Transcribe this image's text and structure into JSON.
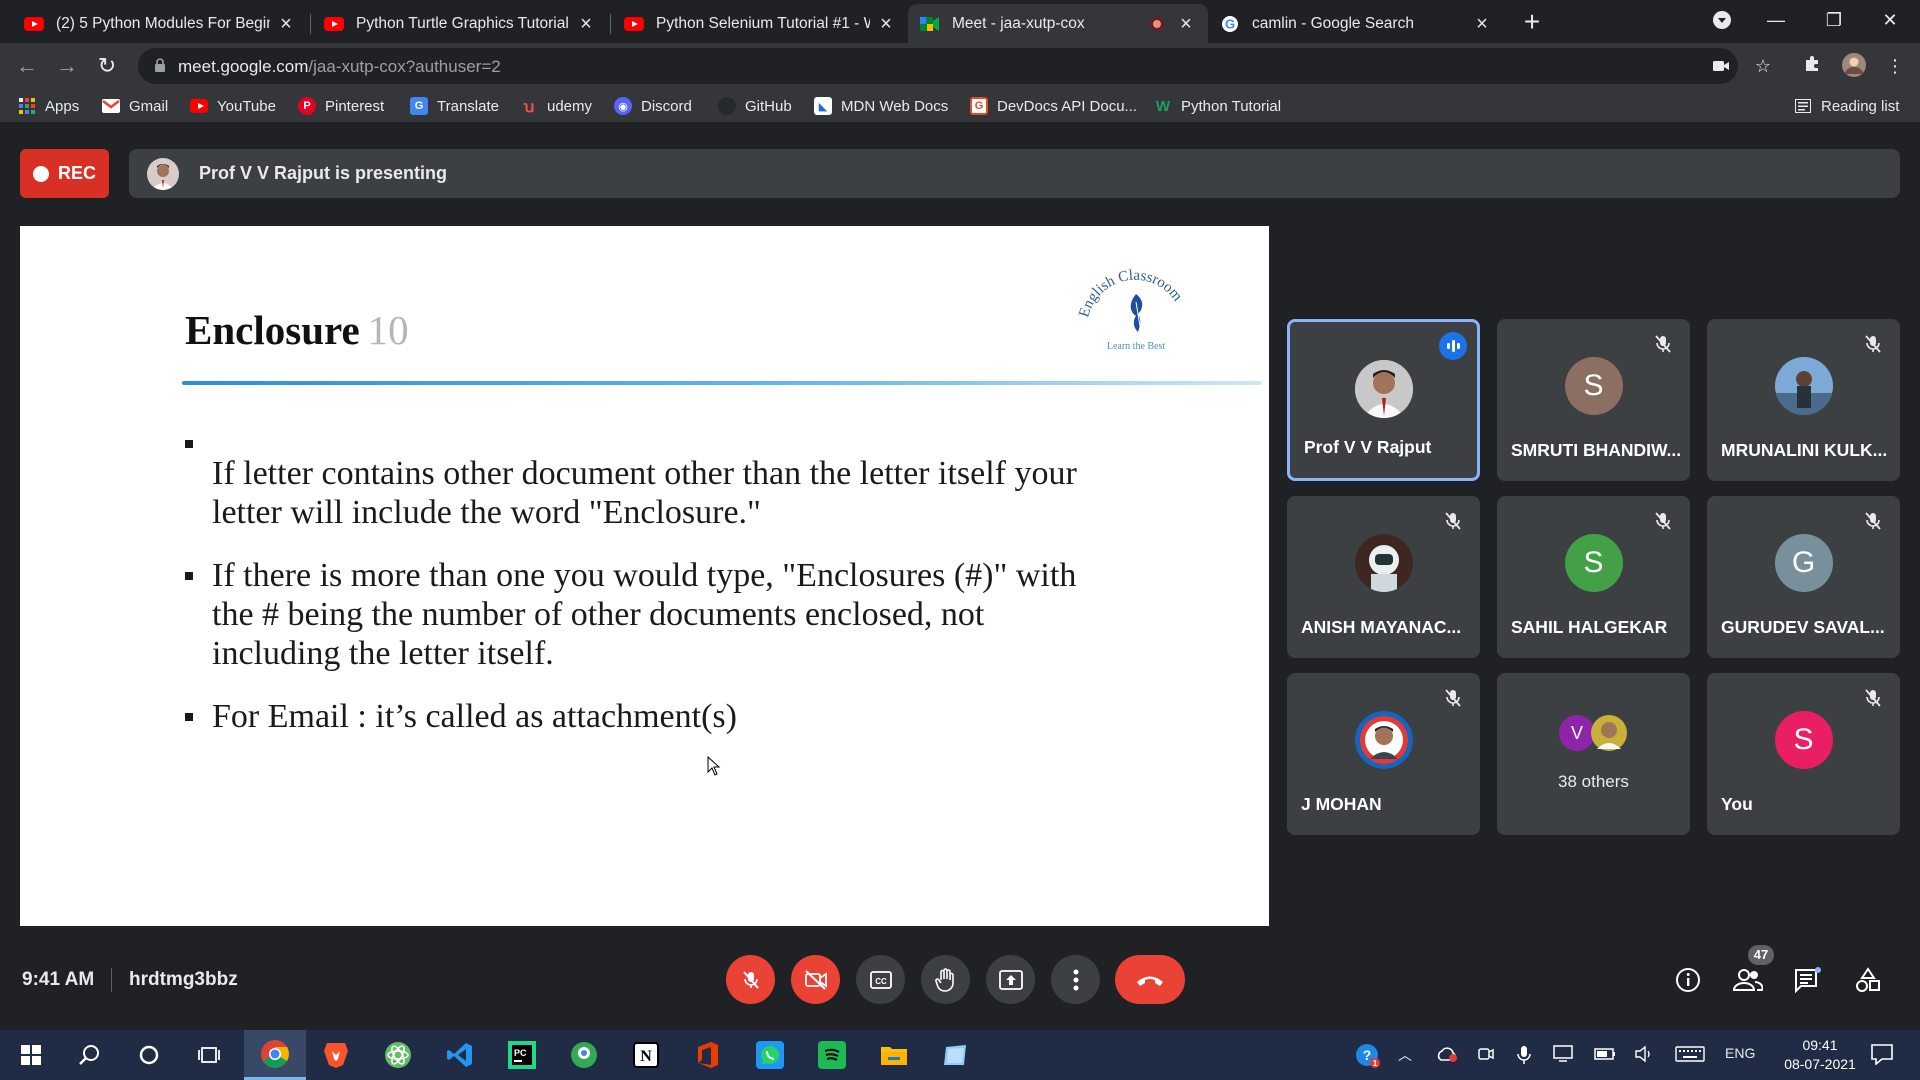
{
  "browser": {
    "tabs": [
      {
        "title": "(2) 5 Python Modules For Beginn",
        "icon": "youtube-icon"
      },
      {
        "title": "Python Turtle Graphics Tutorial #",
        "icon": "youtube-icon"
      },
      {
        "title": "Python Selenium Tutorial #1 - W",
        "icon": "youtube-icon"
      },
      {
        "title": "Meet - jaa-xutp-cox",
        "icon": "google-meet-icon",
        "active": true,
        "recording": true
      },
      {
        "title": "camlin - Google Search",
        "icon": "google-icon"
      }
    ],
    "address": {
      "host": "meet.google.com",
      "path": "/jaa-xutp-cox?authuser=2"
    },
    "bookmarks": [
      {
        "label": "Apps",
        "icon": "apps-grid-icon",
        "color": "#4285f4"
      },
      {
        "label": "Gmail",
        "icon": "gmail-icon",
        "color": "#ea4335"
      },
      {
        "label": "YouTube",
        "icon": "youtube-icon",
        "color": "#ff0000"
      },
      {
        "label": "Pinterest",
        "icon": "pinterest-icon",
        "color": "#e60023"
      },
      {
        "label": "Translate",
        "icon": "translate-icon",
        "color": "#4285f4"
      },
      {
        "label": "udemy",
        "icon": "udemy-icon",
        "color": "#ec5252"
      },
      {
        "label": "Discord",
        "icon": "discord-icon",
        "color": "#5865f2"
      },
      {
        "label": "GitHub",
        "icon": "github-icon",
        "color": "#24292e"
      },
      {
        "label": "MDN Web Docs",
        "icon": "mdn-icon",
        "color": "#1b6fc8"
      },
      {
        "label": "DevDocs API Docu...",
        "icon": "devdocs-icon",
        "color": "#e34c26"
      },
      {
        "label": "Python Tutorial",
        "icon": "python-tutorial-icon",
        "color": "#1aa260"
      }
    ],
    "reading_list": "Reading list"
  },
  "meet": {
    "rec_label": "REC",
    "presenting_text": "Prof V V Rajput is presenting",
    "slide": {
      "title": "Enclosure",
      "number": "10",
      "logo_text": "English Classroom",
      "logo_tagline": "Learn the Best",
      "bullets": [
        "If letter contains other document other than the letter itself your letter will include the word \"Enclosure.\"",
        "If there is more than one you would type, \"Enclosures (#)\" with the # being the number of other documents enclosed, not including the letter itself.",
        "For Email : it’s called as attachment(s)"
      ]
    },
    "participants": [
      {
        "name": "Prof V V Rajput",
        "avatar": "photo",
        "speaking": true
      },
      {
        "name": "SMRUTI BHANDIW...",
        "initial": "S",
        "color": "#8d6e63",
        "muted": true
      },
      {
        "name": "MRUNALINI KULK...",
        "avatar": "photo",
        "muted": true
      },
      {
        "name": "ANISH MAYANAC...",
        "avatar": "photo",
        "muted": true
      },
      {
        "name": "SAHIL HALGEKAR",
        "initial": "S",
        "color": "#43a047",
        "muted": true
      },
      {
        "name": "GURUDEV SAVAL...",
        "initial": "G",
        "color": "#78909c",
        "muted": true
      },
      {
        "name": "J MOHAN",
        "avatar": "photo",
        "muted": true
      },
      {
        "others_label": "38 others",
        "initial": "V",
        "color": "#8e24aa"
      },
      {
        "name": "You",
        "initial": "S",
        "color": "#e91e63",
        "muted": true
      }
    ],
    "bottom": {
      "time": "9:41 AM",
      "code": "hrdtmg3bbz",
      "people_count": "47"
    }
  },
  "taskbar": {
    "language": "ENG",
    "time": "09:41",
    "date": "08-07-2021"
  }
}
